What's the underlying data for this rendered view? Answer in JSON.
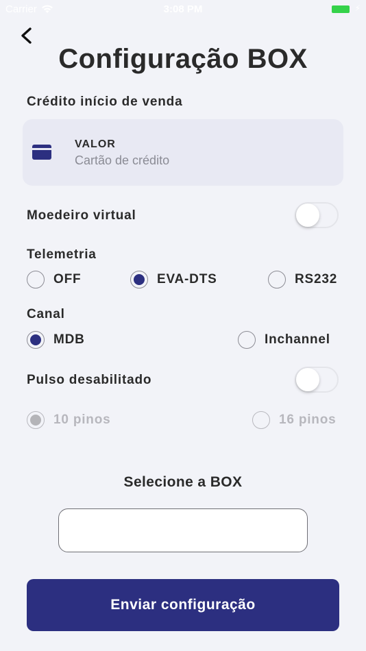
{
  "status_bar": {
    "carrier": "Carrier",
    "time": "3:08 PM"
  },
  "title": "Configuração BOX",
  "credit_section": {
    "label": "Crédito início de venda",
    "valor_label": "VALOR",
    "valor_value": "Cartão de crédito",
    "icon": "credit-card-icon"
  },
  "moedeiro": {
    "label": "Moedeiro virtual",
    "on": false
  },
  "telemetria": {
    "label": "Telemetria",
    "options": [
      "OFF",
      "EVA-DTS",
      "RS232"
    ],
    "selected": "EVA-DTS"
  },
  "canal": {
    "label": "Canal",
    "options": [
      "MDB",
      "Inchannel"
    ],
    "selected": "MDB"
  },
  "pulso": {
    "label": "Pulso desabilitado",
    "on": false,
    "options": [
      "10 pinos",
      "16 pinos"
    ],
    "selected": "10 pinos"
  },
  "select_box": {
    "title": "Selecione a BOX",
    "value": "",
    "placeholder": ""
  },
  "send_button": "Enviar configuração",
  "colors": {
    "background": "#f2f3f8",
    "accent": "#2c2f80",
    "card_bg": "#e8e9f3",
    "battery": "#35d24a"
  }
}
